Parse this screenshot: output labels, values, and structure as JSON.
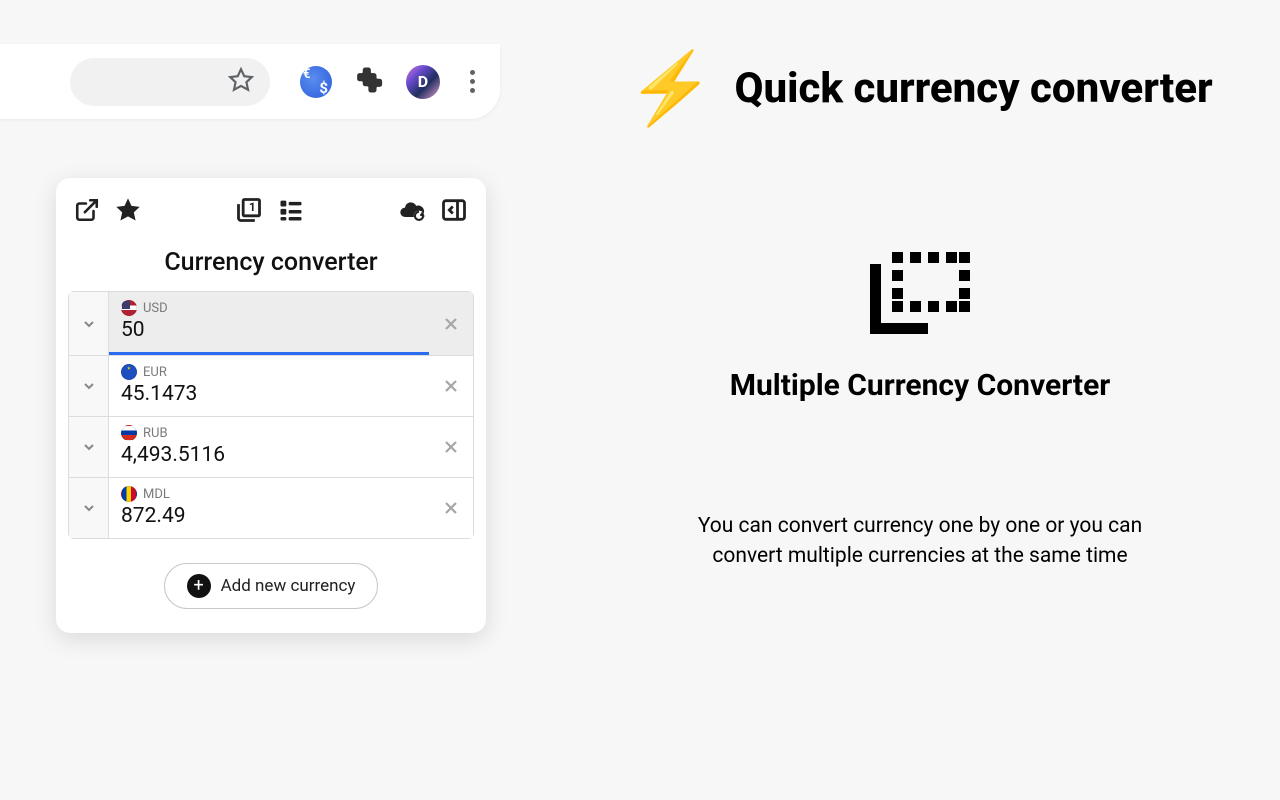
{
  "headline": "Quick currency converter",
  "feature_title": "Multiple Currency Converter",
  "feature_desc": "You can convert currency one by one or you can convert multiple currencies at the same time",
  "popup": {
    "title": "Currency converter",
    "add_label": "Add new currency",
    "currencies": [
      {
        "code": "USD",
        "value": "50",
        "flag": "flag-usd",
        "active": true
      },
      {
        "code": "EUR",
        "value": "45.1473",
        "flag": "flag-eur",
        "active": false
      },
      {
        "code": "RUB",
        "value": "4,493.5116",
        "flag": "flag-rub",
        "active": false
      },
      {
        "code": "MDL",
        "value": "872.49",
        "flag": "flag-mdl",
        "active": false
      }
    ]
  },
  "avatar_letter": "D"
}
